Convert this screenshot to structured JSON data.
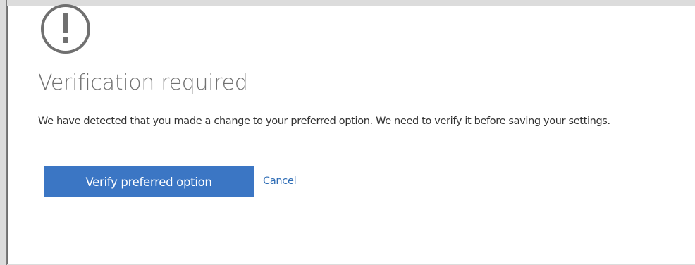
{
  "dialog": {
    "icon": "exclamation-circle-icon",
    "title": "Verification required",
    "message": "We have detected that you made a change to your preferred option. We need to verify it before saving your settings.",
    "primary_button_label": "Verify preferred option",
    "cancel_label": "Cancel"
  },
  "colors": {
    "primary_button": "#3b76c4",
    "link": "#2f6db5",
    "title_text": "#707070",
    "body_text": "#333333",
    "icon": "#707070"
  }
}
